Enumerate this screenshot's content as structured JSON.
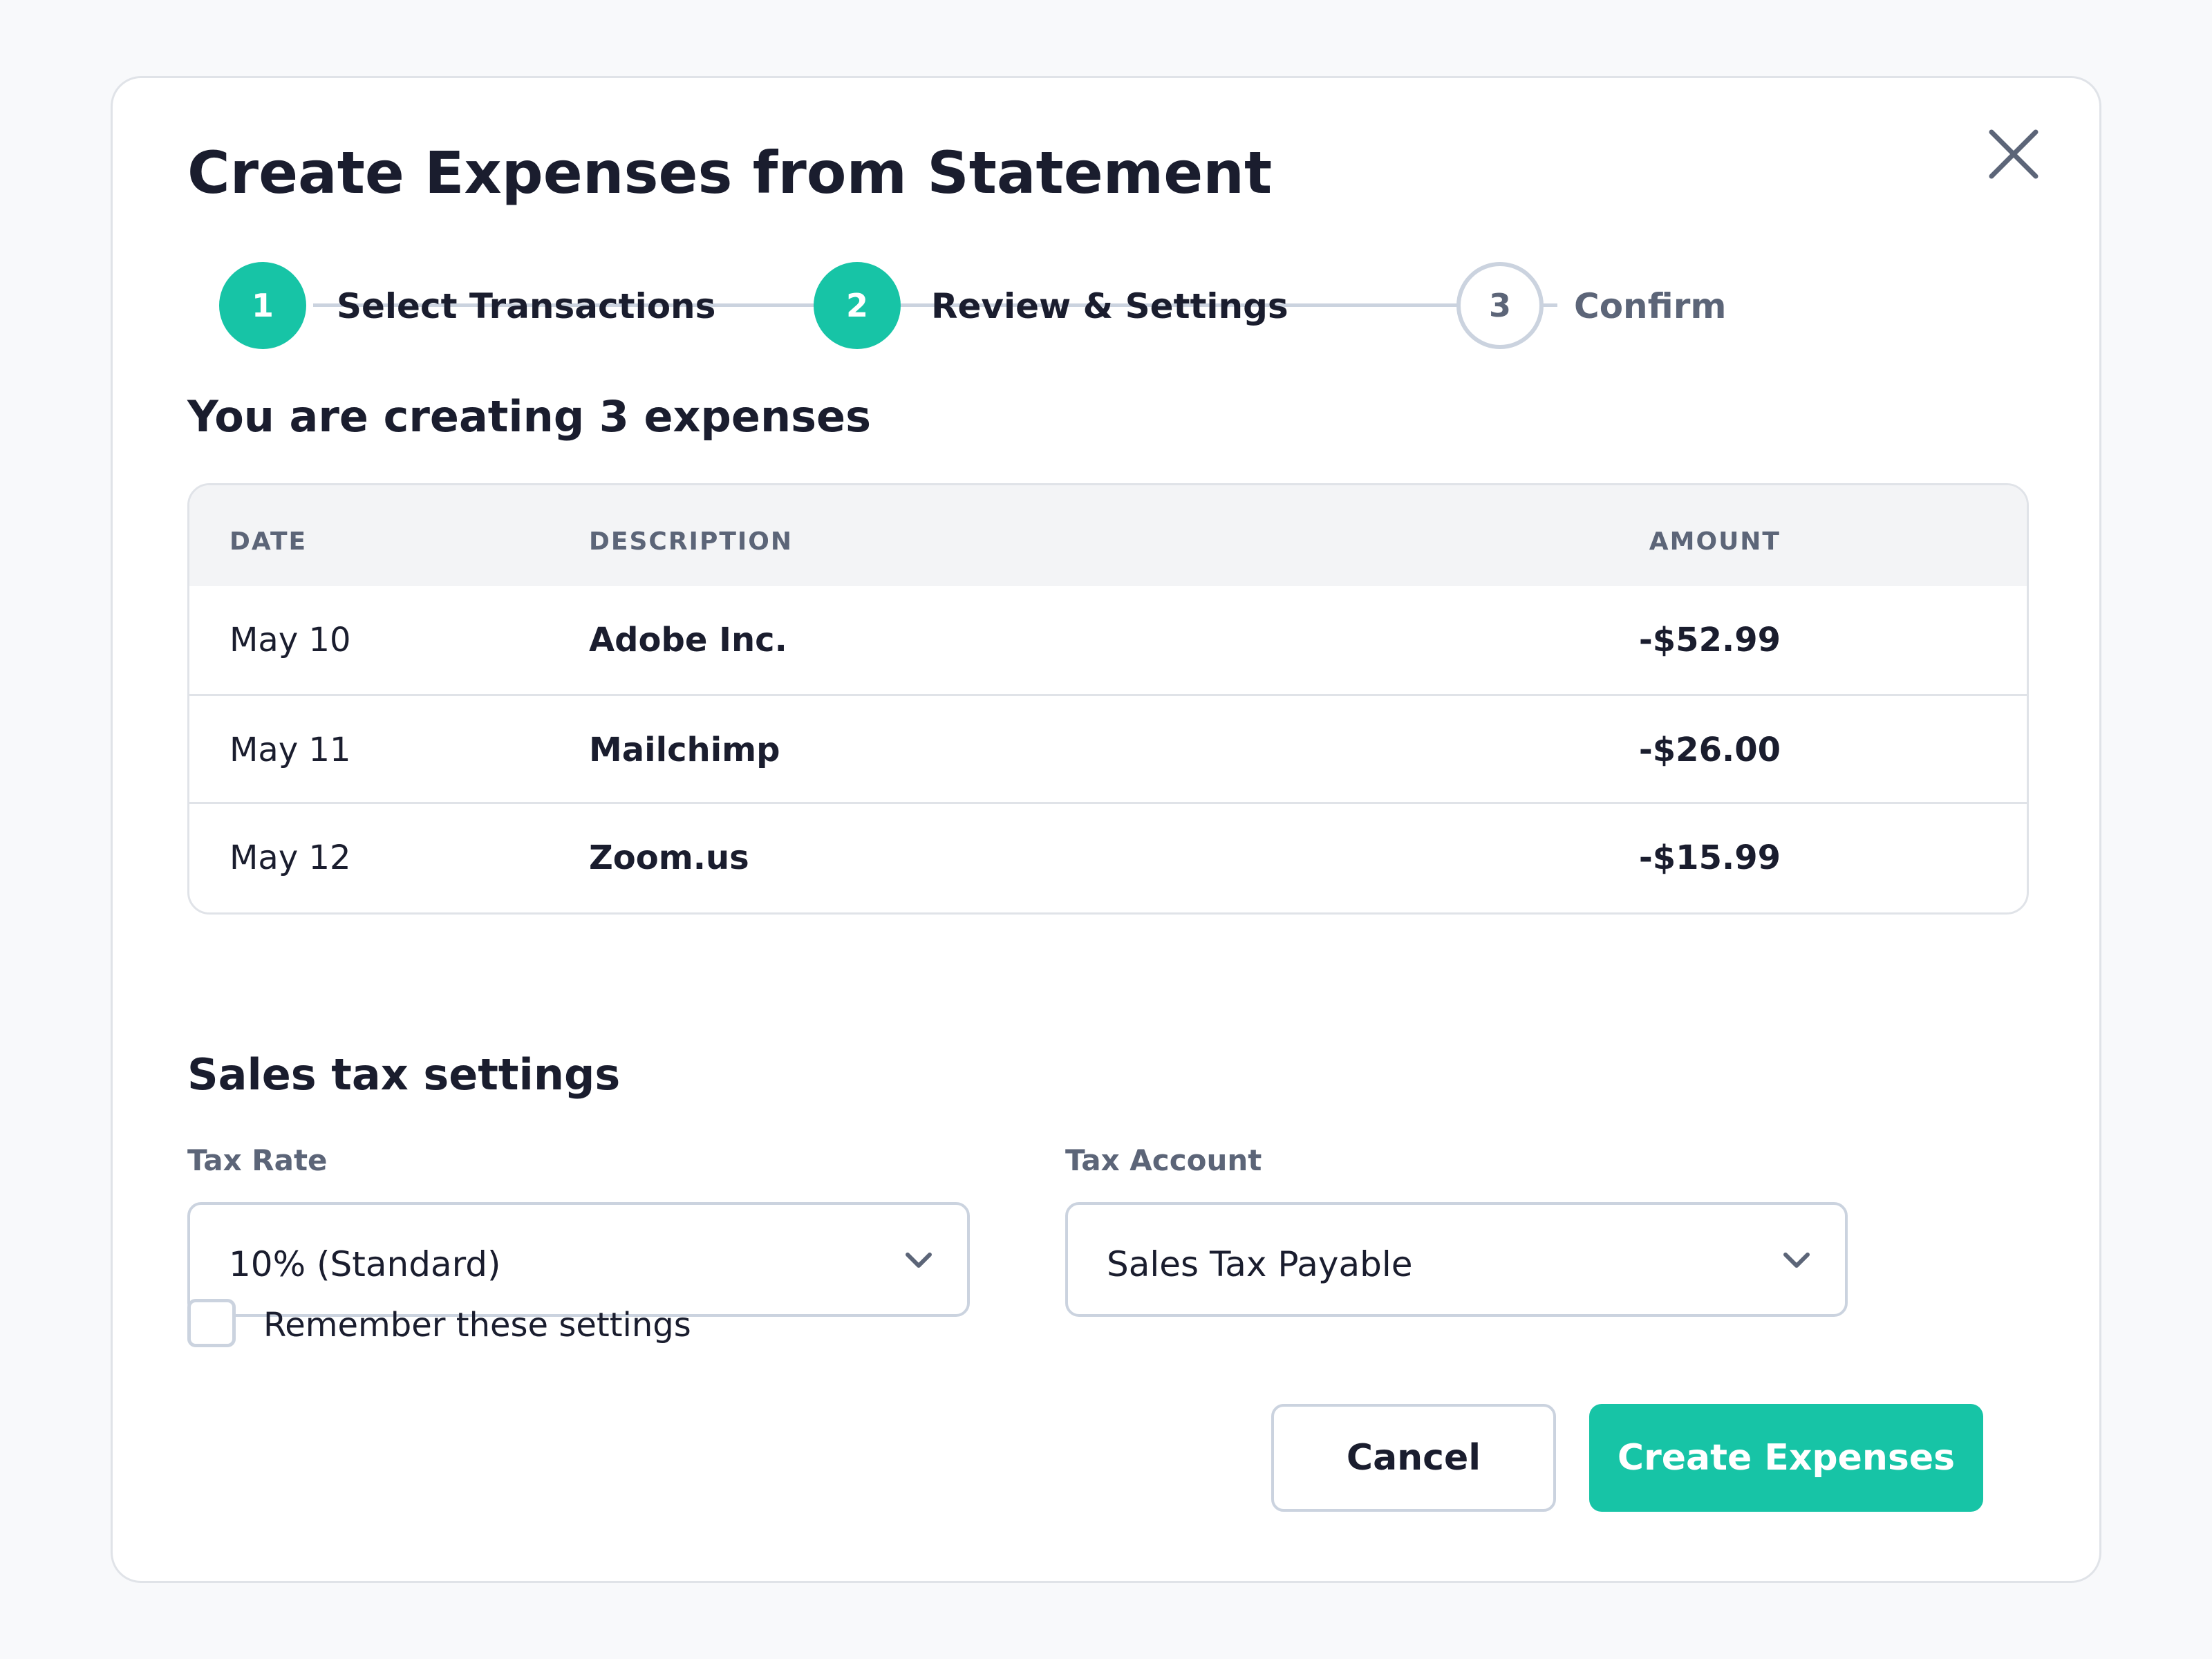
{
  "dialog": {
    "title": "Create Expenses from Statement",
    "close_icon": "close-icon"
  },
  "stepper": {
    "steps": [
      {
        "number": "1",
        "label": "Select Transactions",
        "state": "complete"
      },
      {
        "number": "2",
        "label": "Review & Settings",
        "state": "current"
      },
      {
        "number": "3",
        "label": "Confirm",
        "state": "pending"
      }
    ]
  },
  "summary": {
    "heading": "You are creating 3 expenses"
  },
  "table": {
    "columns": {
      "date": "DATE",
      "description": "DESCRIPTION",
      "amount": "AMOUNT"
    },
    "rows": [
      {
        "date": "May 10",
        "description": "Adobe Inc.",
        "amount": "-$52.99"
      },
      {
        "date": "May 11",
        "description": "Mailchimp",
        "amount": "-$26.00"
      },
      {
        "date": "May 12",
        "description": "Zoom.us",
        "amount": "-$15.99"
      }
    ]
  },
  "tax_settings": {
    "heading": "Sales tax settings",
    "tax_rate": {
      "label": "Tax Rate",
      "value": "10% (Standard)"
    },
    "tax_account": {
      "label": "Tax Account",
      "value": "Sales Tax Payable"
    },
    "remember": {
      "label": "Remember these settings",
      "checked": false
    }
  },
  "actions": {
    "cancel": "Cancel",
    "create": "Create Expenses"
  },
  "colors": {
    "accent": "#17c4a6",
    "text": "#1a1d2e",
    "muted": "#5c6578",
    "border": "#cbd3df"
  }
}
